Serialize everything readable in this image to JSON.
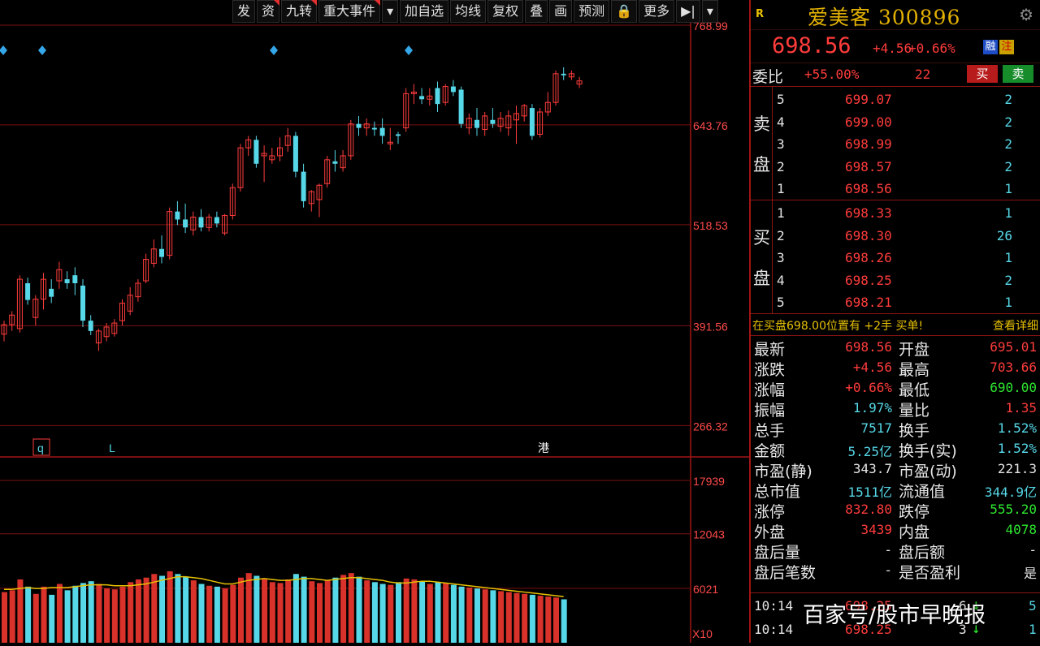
{
  "toolbar": [
    "发",
    "资",
    "九转",
    "重大事件",
    "▾",
    "加自选",
    "均线",
    "复权",
    "叠",
    "画",
    "预测",
    "🔒",
    "更多",
    "▶|",
    "▾"
  ],
  "chart": {
    "price_axis": [
      "768.99",
      "643.76",
      "518.53",
      "391.56",
      "266.32"
    ],
    "volume_axis": [
      "17939",
      "12043",
      "6021"
    ],
    "volume_unit": "X10",
    "markers": [
      "q",
      "L",
      "港"
    ]
  },
  "chart_data": {
    "type": "candlestick",
    "price_range": [
      230,
      770
    ],
    "volume_range": [
      0,
      17939
    ],
    "candles": [
      {
        "o": 381,
        "h": 398,
        "l": 372,
        "c": 393
      },
      {
        "o": 393,
        "h": 410,
        "l": 385,
        "c": 405
      },
      {
        "o": 388,
        "h": 455,
        "l": 383,
        "c": 450
      },
      {
        "o": 445,
        "h": 452,
        "l": 418,
        "c": 424
      },
      {
        "o": 402,
        "h": 430,
        "l": 392,
        "c": 425
      },
      {
        "o": 425,
        "h": 458,
        "l": 412,
        "c": 450
      },
      {
        "o": 438,
        "h": 450,
        "l": 420,
        "c": 428
      },
      {
        "o": 448,
        "h": 472,
        "l": 438,
        "c": 462
      },
      {
        "o": 450,
        "h": 460,
        "l": 438,
        "c": 445
      },
      {
        "o": 455,
        "h": 465,
        "l": 430,
        "c": 445
      },
      {
        "o": 442,
        "h": 450,
        "l": 390,
        "c": 398
      },
      {
        "o": 398,
        "h": 405,
        "l": 380,
        "c": 385
      },
      {
        "o": 370,
        "h": 388,
        "l": 360,
        "c": 385
      },
      {
        "o": 378,
        "h": 395,
        "l": 372,
        "c": 390
      },
      {
        "o": 382,
        "h": 400,
        "l": 378,
        "c": 395
      },
      {
        "o": 398,
        "h": 425,
        "l": 392,
        "c": 420
      },
      {
        "o": 410,
        "h": 440,
        "l": 405,
        "c": 430
      },
      {
        "o": 428,
        "h": 450,
        "l": 422,
        "c": 445
      },
      {
        "o": 448,
        "h": 482,
        "l": 445,
        "c": 475
      },
      {
        "o": 470,
        "h": 500,
        "l": 465,
        "c": 488
      },
      {
        "o": 488,
        "h": 505,
        "l": 470,
        "c": 478
      },
      {
        "o": 480,
        "h": 540,
        "l": 475,
        "c": 535
      },
      {
        "o": 535,
        "h": 548,
        "l": 518,
        "c": 525
      },
      {
        "o": 525,
        "h": 545,
        "l": 508,
        "c": 515
      },
      {
        "o": 512,
        "h": 535,
        "l": 505,
        "c": 528
      },
      {
        "o": 528,
        "h": 538,
        "l": 510,
        "c": 515
      },
      {
        "o": 515,
        "h": 532,
        "l": 510,
        "c": 528
      },
      {
        "o": 528,
        "h": 535,
        "l": 515,
        "c": 520
      },
      {
        "o": 508,
        "h": 532,
        "l": 505,
        "c": 530
      },
      {
        "o": 530,
        "h": 570,
        "l": 525,
        "c": 565
      },
      {
        "o": 565,
        "h": 620,
        "l": 560,
        "c": 615
      },
      {
        "o": 615,
        "h": 630,
        "l": 605,
        "c": 625
      },
      {
        "o": 625,
        "h": 630,
        "l": 590,
        "c": 595
      },
      {
        "o": 605,
        "h": 618,
        "l": 572,
        "c": 608
      },
      {
        "o": 600,
        "h": 615,
        "l": 595,
        "c": 605
      },
      {
        "o": 605,
        "h": 628,
        "l": 598,
        "c": 615
      },
      {
        "o": 618,
        "h": 640,
        "l": 610,
        "c": 630
      },
      {
        "o": 630,
        "h": 635,
        "l": 578,
        "c": 585
      },
      {
        "o": 585,
        "h": 595,
        "l": 540,
        "c": 548
      },
      {
        "o": 545,
        "h": 562,
        "l": 535,
        "c": 560
      },
      {
        "o": 550,
        "h": 570,
        "l": 528,
        "c": 568
      },
      {
        "o": 570,
        "h": 605,
        "l": 565,
        "c": 600
      },
      {
        "o": 598,
        "h": 612,
        "l": 585,
        "c": 595
      },
      {
        "o": 590,
        "h": 612,
        "l": 585,
        "c": 605
      },
      {
        "o": 605,
        "h": 650,
        "l": 600,
        "c": 645
      },
      {
        "o": 645,
        "h": 655,
        "l": 630,
        "c": 640
      },
      {
        "o": 640,
        "h": 652,
        "l": 630,
        "c": 645
      },
      {
        "o": 640,
        "h": 648,
        "l": 630,
        "c": 638
      },
      {
        "o": 640,
        "h": 652,
        "l": 620,
        "c": 630
      },
      {
        "o": 620,
        "h": 640,
        "l": 612,
        "c": 622
      },
      {
        "o": 632,
        "h": 635,
        "l": 620,
        "c": 630
      },
      {
        "o": 640,
        "h": 690,
        "l": 635,
        "c": 683
      },
      {
        "o": 683,
        "h": 695,
        "l": 670,
        "c": 685
      },
      {
        "o": 680,
        "h": 690,
        "l": 670,
        "c": 676
      },
      {
        "o": 676,
        "h": 690,
        "l": 668,
        "c": 680
      },
      {
        "o": 690,
        "h": 698,
        "l": 660,
        "c": 670
      },
      {
        "o": 672,
        "h": 695,
        "l": 668,
        "c": 692
      },
      {
        "o": 692,
        "h": 700,
        "l": 680,
        "c": 685
      },
      {
        "o": 688,
        "h": 692,
        "l": 640,
        "c": 645
      },
      {
        "o": 640,
        "h": 658,
        "l": 632,
        "c": 652
      },
      {
        "o": 650,
        "h": 665,
        "l": 630,
        "c": 640
      },
      {
        "o": 638,
        "h": 660,
        "l": 630,
        "c": 655
      },
      {
        "o": 650,
        "h": 665,
        "l": 640,
        "c": 645
      },
      {
        "o": 642,
        "h": 660,
        "l": 635,
        "c": 652
      },
      {
        "o": 640,
        "h": 662,
        "l": 630,
        "c": 655
      },
      {
        "o": 650,
        "h": 668,
        "l": 620,
        "c": 658
      },
      {
        "o": 655,
        "h": 670,
        "l": 648,
        "c": 668
      },
      {
        "o": 665,
        "h": 670,
        "l": 625,
        "c": 630
      },
      {
        "o": 632,
        "h": 665,
        "l": 628,
        "c": 660
      },
      {
        "o": 660,
        "h": 685,
        "l": 655,
        "c": 672
      },
      {
        "o": 672,
        "h": 712,
        "l": 668,
        "c": 708
      },
      {
        "o": 708,
        "h": 716,
        "l": 700,
        "c": 706
      },
      {
        "o": 704,
        "h": 712,
        "l": 700,
        "c": 708
      },
      {
        "o": 695,
        "h": 704,
        "l": 690,
        "c": 699
      }
    ],
    "volumes": [
      5600,
      5800,
      7000,
      6200,
      5400,
      6200,
      5300,
      6500,
      5800,
      6300,
      6600,
      6800,
      6500,
      6000,
      5900,
      6200,
      6700,
      7000,
      7200,
      7600,
      7400,
      7900,
      7600,
      7300,
      6900,
      6500,
      6300,
      6200,
      6000,
      6400,
      7200,
      7700,
      7400,
      7100,
      6700,
      6600,
      7000,
      7600,
      7300,
      6800,
      6600,
      6900,
      7200,
      7500,
      7700,
      7300,
      6900,
      6700,
      6500,
      6400,
      6700,
      7100,
      7000,
      6800,
      6500,
      6700,
      6600,
      6400,
      6200,
      6100,
      6000,
      5900,
      5800,
      5700,
      5600,
      5500,
      5400,
      5300,
      5200,
      5100,
      5000,
      4800
    ],
    "ma5": [
      5900,
      5900,
      6000,
      6100,
      6000,
      6000,
      6100,
      6100,
      6100,
      6200,
      6300,
      6400,
      6400,
      6400,
      6300,
      6300,
      6300,
      6400,
      6500,
      6700,
      6900,
      7100,
      7300,
      7300,
      7200,
      7100,
      6900,
      6700,
      6500,
      6500,
      6700,
      6900,
      7000,
      7100,
      7000,
      6900,
      6900,
      7000,
      7100,
      7100,
      7000,
      6900,
      7000,
      7100,
      7200,
      7200,
      7100,
      7000,
      6900,
      6700,
      6600,
      6600,
      6700,
      6800,
      6800,
      6700,
      6600,
      6500,
      6400,
      6300,
      6200,
      6100,
      6000,
      5900,
      5800,
      5700,
      5600,
      5500,
      5400,
      5300,
      5200,
      5100
    ]
  },
  "stock": {
    "badge": "R",
    "name": "爱美客 300896",
    "price": "698.56",
    "change": "+4.56",
    "change_pct": "+0.66%",
    "tag_rong": "融",
    "tag_zhu": "注"
  },
  "weibi": {
    "label": "委比",
    "value": "+55.00%",
    "diff": "22",
    "buy": "买",
    "sell": "卖"
  },
  "sell_side": {
    "label_1": "卖",
    "label_2": "盘",
    "rows": [
      {
        "lv": "5",
        "px": "699.07",
        "vol": "2"
      },
      {
        "lv": "4",
        "px": "699.00",
        "vol": "2"
      },
      {
        "lv": "3",
        "px": "698.99",
        "vol": "2"
      },
      {
        "lv": "2",
        "px": "698.57",
        "vol": "2"
      },
      {
        "lv": "1",
        "px": "698.56",
        "vol": "1"
      }
    ]
  },
  "buy_side": {
    "label_1": "买",
    "label_2": "盘",
    "rows": [
      {
        "lv": "1",
        "px": "698.33",
        "vol": "1"
      },
      {
        "lv": "2",
        "px": "698.30",
        "vol": "26"
      },
      {
        "lv": "3",
        "px": "698.26",
        "vol": "1"
      },
      {
        "lv": "4",
        "px": "698.25",
        "vol": "2"
      },
      {
        "lv": "5",
        "px": "698.21",
        "vol": "1"
      }
    ]
  },
  "notice": {
    "message": "在买盘698.00位置有 +2手 买单!",
    "detail": "查看详细"
  },
  "stats": [
    {
      "k1": "最新",
      "v1": "698.56",
      "c1": "red",
      "k2": "开盘",
      "v2": "695.01",
      "c2": "red"
    },
    {
      "k1": "涨跌",
      "v1": "+4.56",
      "c1": "red",
      "k2": "最高",
      "v2": "703.66",
      "c2": "red"
    },
    {
      "k1": "涨幅",
      "v1": "+0.66%",
      "c1": "red",
      "k2": "最低",
      "v2": "690.00",
      "c2": "green"
    },
    {
      "k1": "振幅",
      "v1": "1.97%",
      "c1": "cyan",
      "k2": "量比",
      "v2": "1.35",
      "c2": "red"
    },
    {
      "k1": "总手",
      "v1": "7517",
      "c1": "cyan",
      "k2": "换手",
      "v2": "1.52%",
      "c2": "cyan"
    },
    {
      "k1": "金额",
      "v1": "5.25亿",
      "c1": "cyan",
      "k2": "换手(实)",
      "v2": "1.52%",
      "c2": "cyan"
    },
    {
      "k1": "市盈(静)",
      "v1": "343.7",
      "c1": "white",
      "k2": "市盈(动)",
      "v2": "221.3",
      "c2": "white"
    },
    {
      "k1": "总市值",
      "v1": "1511亿",
      "c1": "cyan",
      "k2": "流通值",
      "v2": "344.9亿",
      "c2": "cyan"
    },
    {
      "k1": "涨停",
      "v1": "832.80",
      "c1": "red",
      "k2": "跌停",
      "v2": "555.20",
      "c2": "green"
    },
    {
      "k1": "外盘",
      "v1": "3439",
      "c1": "red",
      "k2": "内盘",
      "v2": "4078",
      "c2": "green"
    },
    {
      "k1": "盘后量",
      "v1": "-",
      "c1": "white",
      "k2": "盘后额",
      "v2": "-",
      "c2": "white"
    },
    {
      "k1": "盘后笔数",
      "v1": "-",
      "c1": "white",
      "k2": "是否盈利",
      "v2": "是",
      "c2": "white"
    }
  ],
  "ticks": [
    {
      "t": "10:14",
      "p": "698.25",
      "n": "6",
      "a": "↓",
      "m": "5"
    },
    {
      "t": "10:14",
      "p": "698.25",
      "n": "3",
      "a": "↓",
      "m": "1"
    }
  ],
  "watermark": "百家号/股市早晚报",
  "colors": {
    "up": "#ff3c3c",
    "down": "#56d8e8",
    "grid": "#7a1010",
    "ma": "#e6c000"
  }
}
